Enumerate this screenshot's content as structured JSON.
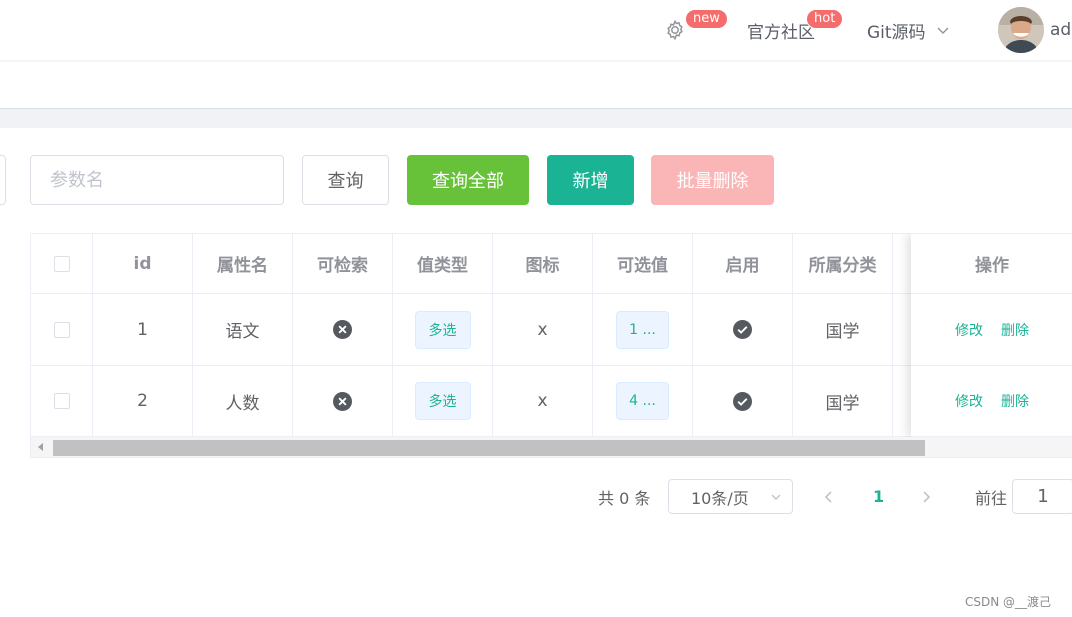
{
  "header": {
    "badge_new": "new",
    "community": "官方社区",
    "badge_hot": "hot",
    "git": "Git源码",
    "user": "adr"
  },
  "search": {
    "placeholder": "参数名"
  },
  "buttons": {
    "query": "查询",
    "query_all": "查询全部",
    "add": "新增",
    "batch_delete": "批量删除"
  },
  "colors": {
    "success": "#67c23a",
    "primary": "#1ab394",
    "danger_light": "#fab6b6"
  },
  "table": {
    "columns": [
      "id",
      "属性名",
      "可检索",
      "值类型",
      "图标",
      "可选值",
      "启用",
      "所属分类"
    ],
    "action_header": "操作",
    "rows": [
      {
        "id": "1",
        "name": "语文",
        "searchable_icon": "x-circle-icon",
        "value_type": "多选",
        "icon": "x",
        "options": "1 ...",
        "enabled_icon": "check-circle-icon",
        "category": "国学",
        "edit": "修改",
        "delete": "删除"
      },
      {
        "id": "2",
        "name": "人数",
        "searchable_icon": "x-circle-icon",
        "value_type": "多选",
        "icon": "x",
        "options": "4 ...",
        "enabled_icon": "check-circle-icon",
        "category": "国学",
        "edit": "修改",
        "delete": "删除"
      }
    ]
  },
  "pagination": {
    "total": "共 0 条",
    "page_size": "10条/页",
    "current_page": "1",
    "goto_label": "前往",
    "goto_value": "1"
  },
  "watermark": "CSDN @__渡己"
}
